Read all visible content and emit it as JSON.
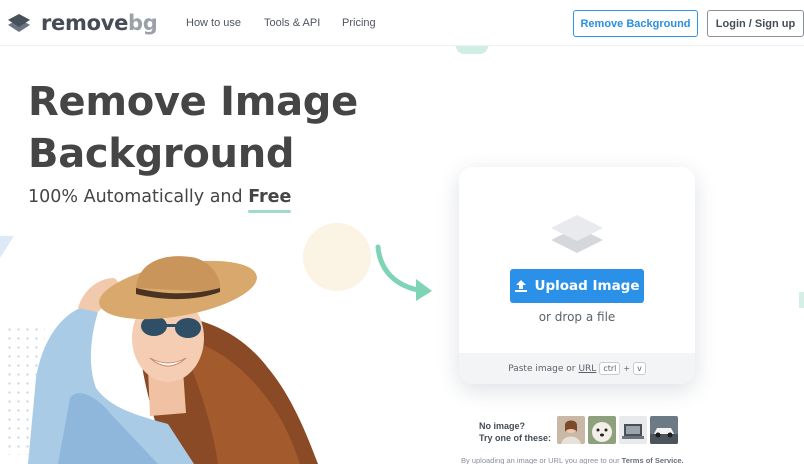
{
  "nav": {
    "brand_main": "remove",
    "brand_accent": "bg",
    "links": [
      "How to use",
      "Tools & API",
      "Pricing"
    ],
    "remove_background_label": "Remove Background",
    "login_label": "Login / Sign up"
  },
  "hero": {
    "title_line1": "Remove Image",
    "title_line2": "Background",
    "subtitle_prefix": "100% Automatically and ",
    "subtitle_emphasis": "Free"
  },
  "upload": {
    "button_label": "Upload Image",
    "drop_text": "or drop a file",
    "paste_prefix": "Paste image or",
    "paste_url": "URL",
    "key_ctrl": "ctrl",
    "key_plus": "+",
    "key_v": "v"
  },
  "samples": {
    "line1": "No image?",
    "line2": "Try one of these:",
    "thumbs": [
      "woman-sample",
      "dog-sample",
      "product-sample",
      "car-sample"
    ]
  },
  "terms": {
    "prefix": "By uploading an image or URL you agree to our",
    "link": "Terms of Service."
  },
  "colors": {
    "accent_blue": "#2b91e8",
    "accent_mint": "#9fdcc6",
    "text_dark": "#454545"
  },
  "icons": [
    "logo-layers-icon",
    "layers-stack-icon",
    "upload-arrow-icon",
    "curved-arrow-icon"
  ]
}
